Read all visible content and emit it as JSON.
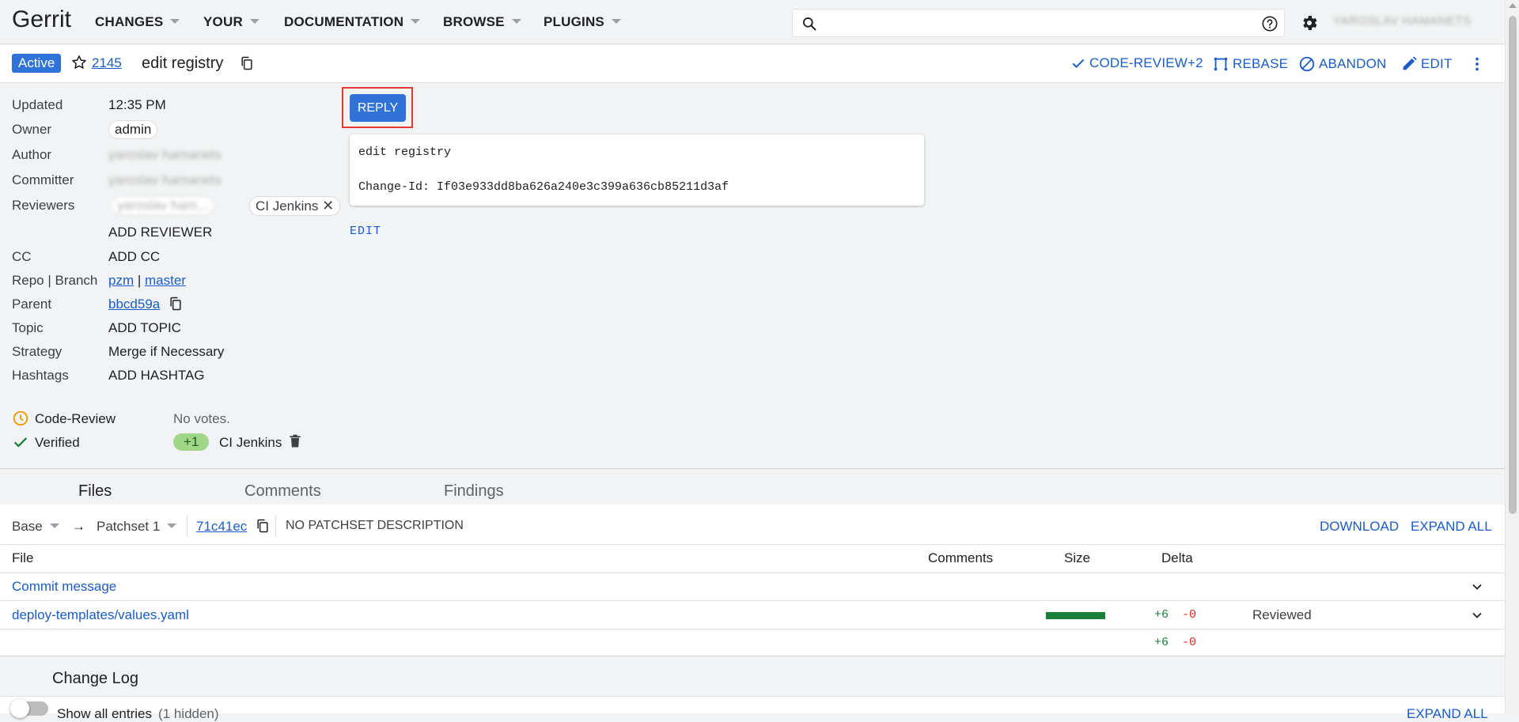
{
  "header": {
    "logo": "Gerrit",
    "nav": [
      {
        "label": "CHANGES"
      },
      {
        "label": "YOUR"
      },
      {
        "label": "DOCUMENTATION"
      },
      {
        "label": "BROWSE"
      },
      {
        "label": "PLUGINS"
      }
    ],
    "search_placeholder": "",
    "user_name": "YAROSLAV HAMANETS"
  },
  "change": {
    "status": "Active",
    "number": "2145",
    "subject": "edit registry",
    "actions": {
      "code_review": "CODE-REVIEW+2",
      "rebase": "REBASE",
      "abandon": "ABANDON",
      "edit": "EDIT"
    }
  },
  "metadata": {
    "updated_label": "Updated",
    "updated_value": "12:35 PM",
    "owner_label": "Owner",
    "owner_value": "admin",
    "author_label": "Author",
    "author_value": "yaroslav hamanets",
    "committer_label": "Committer",
    "committer_value": "yaroslav hamanets",
    "reviewers_label": "Reviewers",
    "reviewer1": "yaroslav ham...",
    "reviewer2": "CI Jenkins",
    "add_reviewer": "ADD REVIEWER",
    "cc_label": "CC",
    "add_cc": "ADD CC",
    "repo_label": "Repo | Branch",
    "repo": "pzm",
    "branch_sep": "|",
    "branch": "master",
    "parent_label": "Parent",
    "parent": "bbcd59a",
    "topic_label": "Topic",
    "add_topic": "ADD TOPIC",
    "strategy_label": "Strategy",
    "strategy": "Merge if Necessary",
    "hashtags_label": "Hashtags",
    "add_hashtag": "ADD HASHTAG"
  },
  "labels": {
    "code_review_label": "Code-Review",
    "code_review_value": "No votes.",
    "verified_label": "Verified",
    "verified_vote": "+1",
    "verified_by": "CI Jenkins"
  },
  "reply": {
    "label": "REPLY"
  },
  "commit_message": {
    "line1": "edit registry",
    "line2": "Change-Id: If03e933dd8ba626a240e3c399a636cb85211d3af",
    "edit": "EDIT"
  },
  "tabs": [
    {
      "label": "Files"
    },
    {
      "label": "Comments"
    },
    {
      "label": "Findings"
    }
  ],
  "files": {
    "base": "Base",
    "arrow": "→",
    "patchset": "Patchset 1",
    "commit": "71c41ec",
    "patchset_desc": "NO PATCHSET DESCRIPTION",
    "download": "DOWNLOAD",
    "expand_all": "EXPAND ALL",
    "col_file": "File",
    "col_comments": "Comments",
    "col_size": "Size",
    "col_delta": "Delta",
    "rows": [
      {
        "name": "Commit message",
        "added": "",
        "removed": "",
        "status": "",
        "size_fraction": 0
      },
      {
        "name": "deploy-templates/values.yaml",
        "added": "+6",
        "removed": "-0",
        "status": "Reviewed",
        "size_fraction": 1
      }
    ],
    "total_added": "+6",
    "total_removed": "-0"
  },
  "changelog": {
    "title": "Change Log",
    "show_all": "Show all entries",
    "hidden": "(1 hidden)",
    "expand_all": "EXPAND ALL"
  }
}
